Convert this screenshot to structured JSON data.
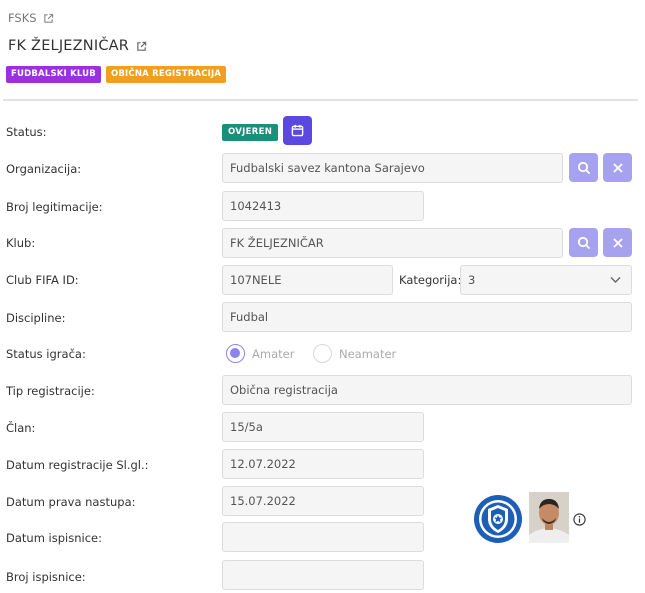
{
  "header": {
    "breadcrumb": "FSKS",
    "title": "FK ŽELJEZNIČAR",
    "badges": [
      {
        "label": "FUDBALSKI KLUB",
        "color": "#9b30e0"
      },
      {
        "label": "OBIČNA REGISTRACIJA",
        "color": "#f0a01e"
      }
    ]
  },
  "form": {
    "status": {
      "label": "Status:",
      "value": "OVJEREN"
    },
    "organizacija": {
      "label": "Organizacija:",
      "value": "Fudbalski savez kantona Sarajevo"
    },
    "broj_legitimacije": {
      "label": "Broj legitimacije:",
      "value": "1042413"
    },
    "klub": {
      "label": "Klub:",
      "value": "FK ŽELJEZNIČAR"
    },
    "club_fifa_id": {
      "label": "Club FIFA ID:",
      "value": "107NELE"
    },
    "kategorija": {
      "label": "Kategorija:",
      "value": "3"
    },
    "discipline": {
      "label": "Discipline:",
      "value": "Fudbal"
    },
    "status_igraca": {
      "label": "Status igrača:",
      "options": [
        "Amater",
        "Neamater"
      ],
      "selected": "Amater"
    },
    "tip_registracije": {
      "label": "Tip registracije:",
      "value": "Obična registracija"
    },
    "clan": {
      "label": "Član:",
      "value": "15/5a"
    },
    "datum_registracije": {
      "label": "Datum registracije Sl.gl.:",
      "value": "12.07.2022"
    },
    "datum_prava_nastupa": {
      "label": "Datum prava nastupa:",
      "value": "15.07.2022"
    },
    "datum_ispisnice": {
      "label": "Datum ispisnice:",
      "value": ""
    },
    "broj_ispisnice": {
      "label": "Broj ispisnice:",
      "value": ""
    }
  },
  "icons": {
    "external": "external-link-icon",
    "calendar": "calendar-icon",
    "search": "search-icon",
    "clear": "close-icon",
    "info": "info-icon",
    "dropdown": "chevron-down-icon"
  },
  "colors": {
    "accent": "#5a48e0",
    "accent_light": "#a7a2ee",
    "verified": "#1a8f7a",
    "club_badge": "#9b30e0",
    "reg_badge": "#f0a01e"
  }
}
